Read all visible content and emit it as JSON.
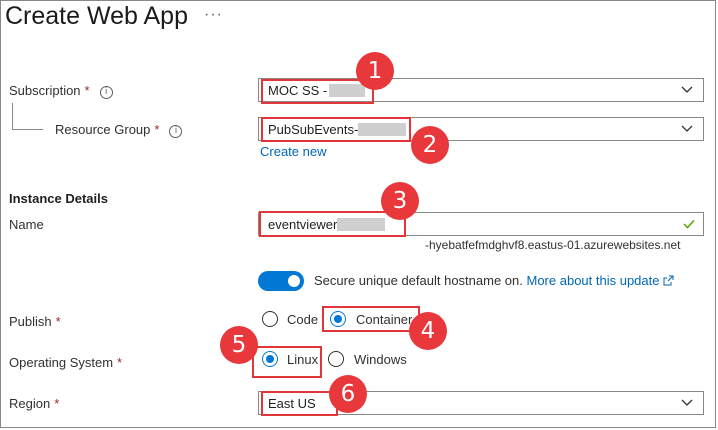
{
  "header": {
    "title": "Create Web App",
    "more": "···"
  },
  "subscription": {
    "label": "Subscription",
    "required": "*",
    "value": "MOC SS -",
    "badge": "1"
  },
  "resource_group": {
    "label": "Resource Group",
    "required": "*",
    "value": "PubSubEvents-",
    "create_new": "Create new",
    "badge": "2"
  },
  "instance": {
    "heading": "Instance Details"
  },
  "name": {
    "label": "Name",
    "required": "*",
    "value": "eventviewer",
    "suffix": "-hyebatfefmdghvf8.eastus-01.azurewebsites.net",
    "badge": "3"
  },
  "hostname": {
    "text": "Secure unique default hostname on.",
    "link": "More about this update",
    "enabled": true
  },
  "publish": {
    "label": "Publish",
    "required": "*",
    "options": [
      "Code",
      "Container"
    ],
    "selected": "Container",
    "badge": "4"
  },
  "os": {
    "label": "Operating System",
    "required": "*",
    "options": [
      "Linux",
      "Windows"
    ],
    "selected": "Linux",
    "badge": "5"
  },
  "region": {
    "label": "Region",
    "required": "*",
    "value": "East US",
    "badge": "6"
  },
  "colors": {
    "accent": "#0078d4",
    "highlight": "#e2373a",
    "badge": "#e8383c",
    "link": "#0067b8"
  }
}
